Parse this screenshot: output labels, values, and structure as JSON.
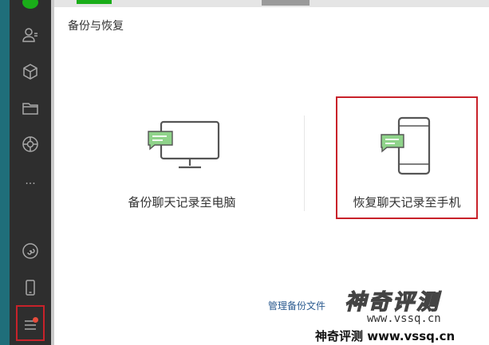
{
  "panel": {
    "title": "备份与恢复"
  },
  "options": {
    "backup_label": "备份聊天记录至电脑",
    "restore_label": "恢复聊天记录至手机"
  },
  "footer": {
    "manage_link": "管理备份文件"
  },
  "watermark": {
    "brand": "神奇评测",
    "url": "www.vssq.cn",
    "footer": "神奇评测 www.vssq.cn"
  },
  "sidebar": {
    "items": [
      {
        "icon": "contacts-icon"
      },
      {
        "icon": "box-icon"
      },
      {
        "icon": "folder-icon"
      },
      {
        "icon": "moments-icon"
      },
      {
        "icon": "more-icon",
        "text": "···"
      },
      {
        "icon": "mini-program-icon"
      },
      {
        "icon": "phone-icon"
      },
      {
        "icon": "menu-icon"
      }
    ]
  },
  "colors": {
    "accent_red": "#c8222a",
    "link_blue": "#2b5a8f",
    "sidebar_bg": "#2e2e2e",
    "wechat_green": "#1aad19"
  }
}
